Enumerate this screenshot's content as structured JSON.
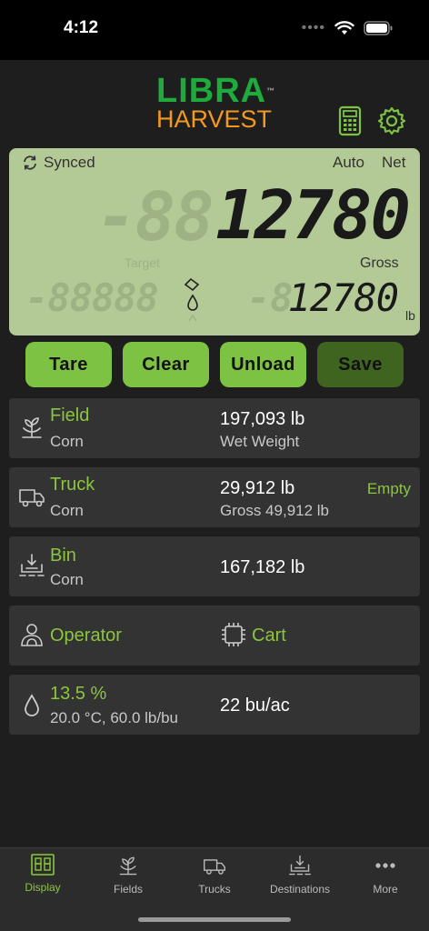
{
  "status": {
    "time": "4:12",
    "dots": "••••"
  },
  "logo": {
    "libra": "LIBRA",
    "tm": "™",
    "harvest": "HARVEST"
  },
  "lcd": {
    "synced": "Synced",
    "auto": "Auto",
    "net": "Net",
    "main_value": "12780",
    "gross": "Gross",
    "target": "Target",
    "second_value": "12780",
    "unit": "lb"
  },
  "buttons": {
    "tare": "Tare",
    "clear": "Clear",
    "unload": "Unload",
    "save": "Save"
  },
  "cards": {
    "field": {
      "title": "Field",
      "sub": "Corn",
      "value": "197,093 lb",
      "value_sub": "Wet Weight"
    },
    "truck": {
      "title": "Truck",
      "sub": "Corn",
      "value": "29,912 lb",
      "value_sub": "Gross 49,912 lb",
      "badge": "Empty"
    },
    "bin": {
      "title": "Bin",
      "sub": "Corn",
      "value": "167,182 lb"
    },
    "operator": {
      "title": "Operator",
      "cart": "Cart"
    },
    "moisture": {
      "title": "13.5 %",
      "sub": "20.0 °C, 60.0 lb/bu",
      "value": "22 bu/ac"
    }
  },
  "tabs": [
    {
      "label": "Display",
      "icon": "display-icon",
      "active": true
    },
    {
      "label": "Fields",
      "icon": "plant-icon"
    },
    {
      "label": "Trucks",
      "icon": "truck-icon"
    },
    {
      "label": "Destinations",
      "icon": "destinations-icon"
    },
    {
      "label": "More",
      "icon": "more-icon"
    }
  ],
  "colors": {
    "accent": "#8cc63f",
    "lcd": "#b4ca96",
    "save": "#3f6420",
    "logo_green": "#1faa3c",
    "logo_orange": "#f39a1e"
  }
}
